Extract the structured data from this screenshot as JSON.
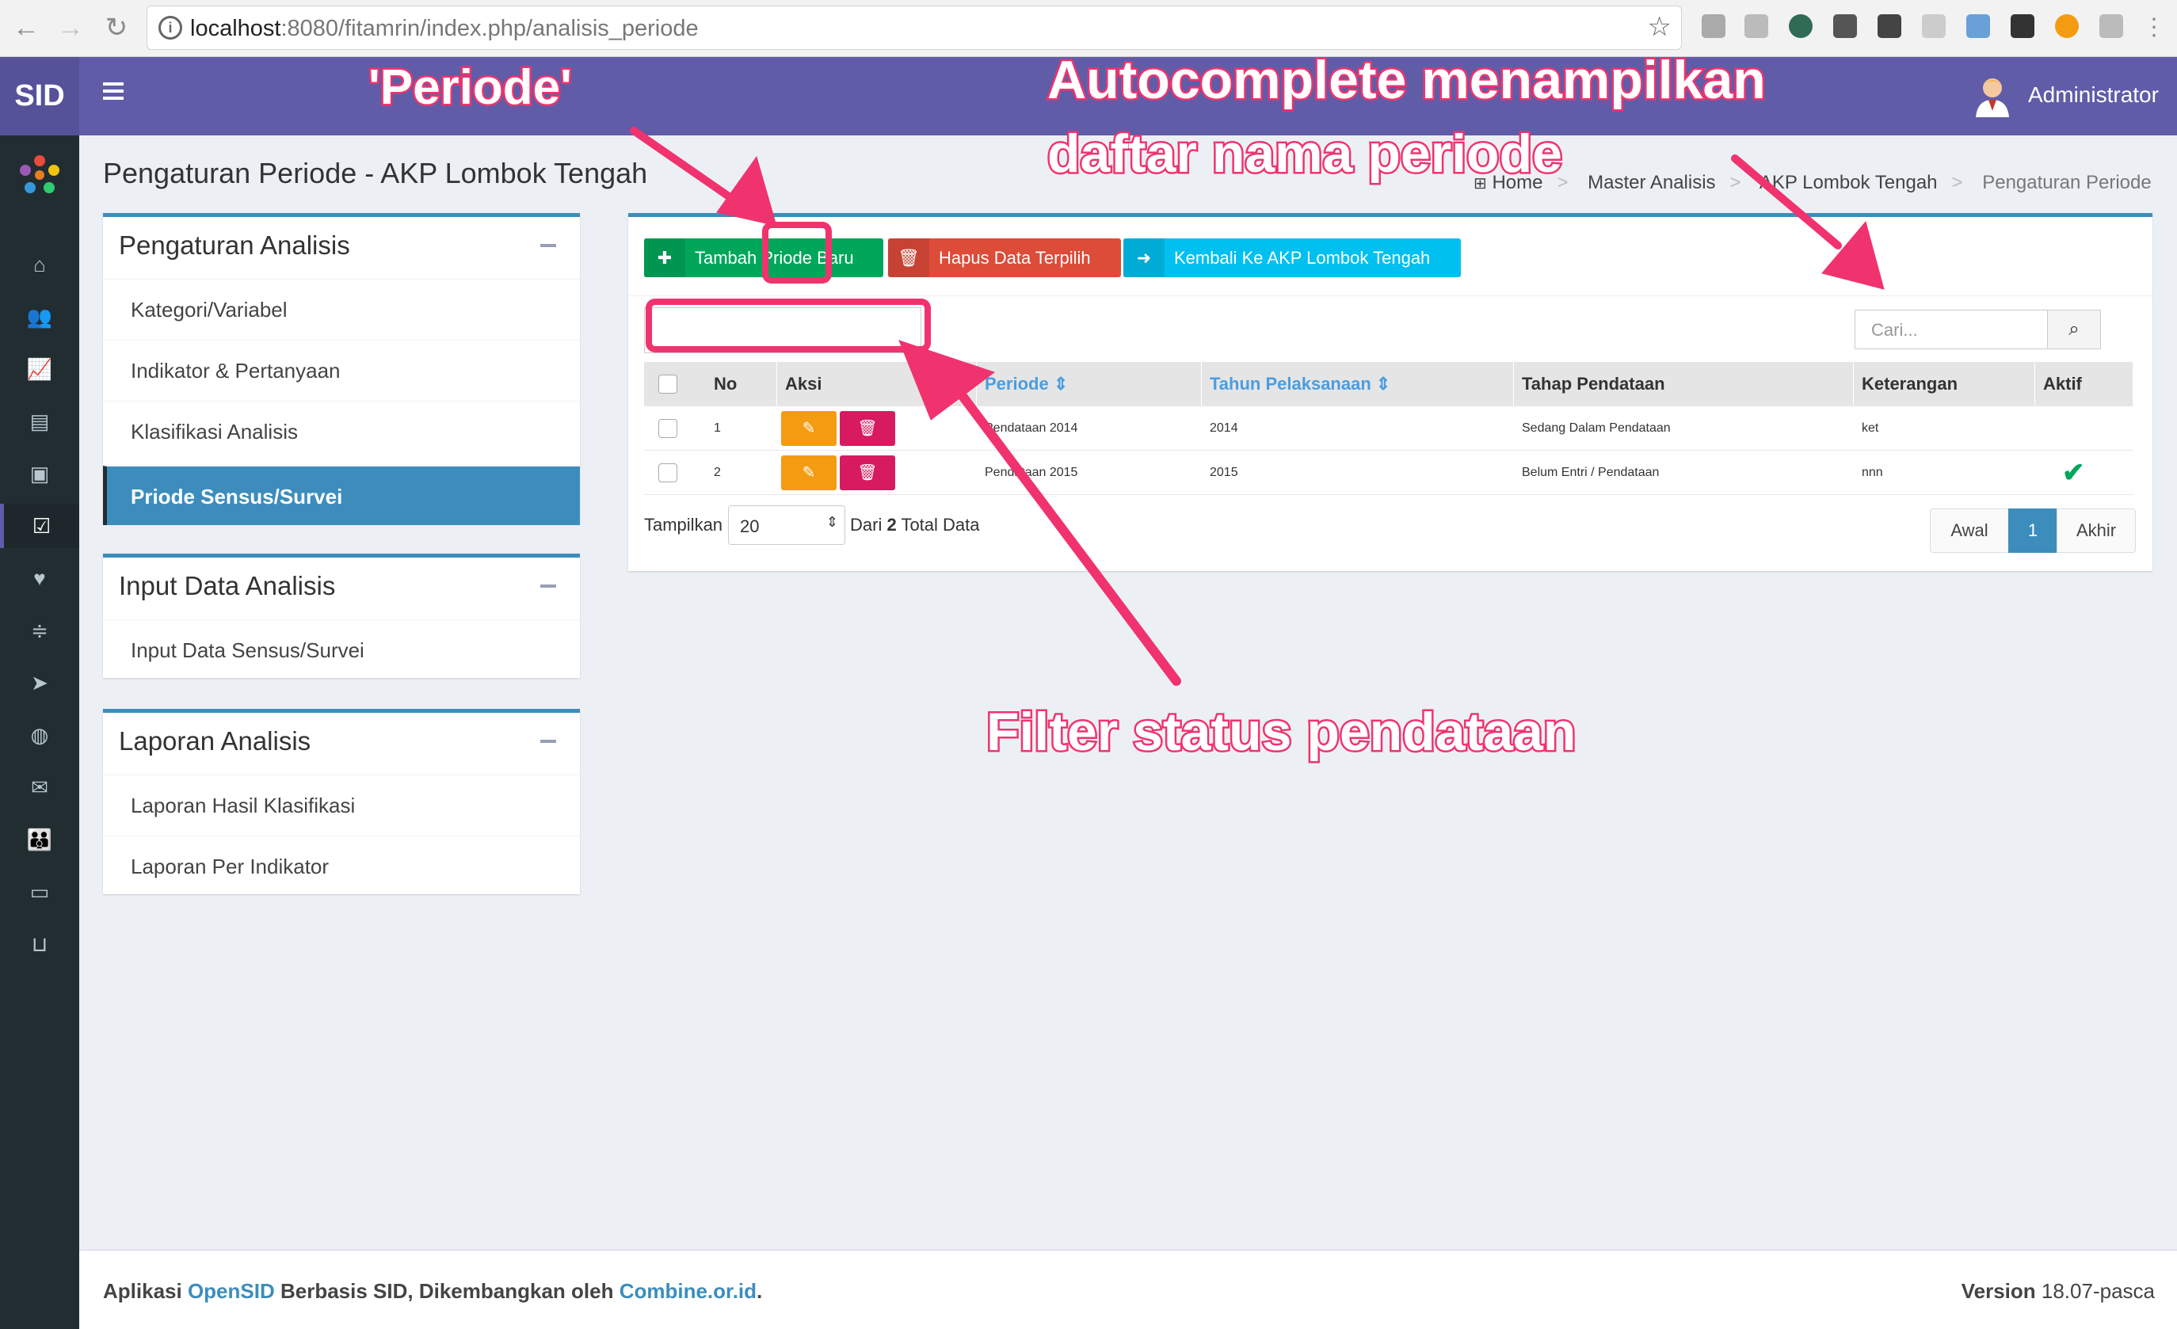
{
  "browser": {
    "url_host": "localhost",
    "url_path": ":8080/fitamrin/index.php/analisis_periode"
  },
  "header": {
    "logo_text": "SID",
    "user_name": "Administrator"
  },
  "page": {
    "title": "Pengaturan Periode - AKP Lombok Tengah",
    "breadcrumb": [
      "Home",
      "Master Analisis",
      "AKP Lombok Tengah",
      "Pengaturan Periode"
    ]
  },
  "sidebar_icons": [
    "home-icon",
    "users-icon",
    "chart-line-icon",
    "book-icon",
    "archive-icon",
    "check-square-icon",
    "heart-icon",
    "sliders-icon",
    "location-arrow-icon",
    "globe-icon",
    "envelope-icon",
    "group-icon",
    "desktop-icon",
    "inbox-icon"
  ],
  "left_menu": {
    "sections": [
      {
        "title": "Pengaturan Analisis",
        "items": [
          "Kategori/Variabel",
          "Indikator & Pertanyaan",
          "Klasifikasi Analisis",
          "Priode Sensus/Survei"
        ],
        "active_index": 3
      },
      {
        "title": "Input Data Analisis",
        "items": [
          "Input Data Sensus/Survei"
        ]
      },
      {
        "title": "Laporan Analisis",
        "items": [
          "Laporan Hasil Klasifikasi",
          "Laporan Per Indikator"
        ]
      }
    ]
  },
  "toolbar": {
    "add_label": "Tambah Priode Baru",
    "delete_label": "Hapus Data Terpilih",
    "back_label": "Kembali Ke AKP Lombok Tengah"
  },
  "search": {
    "placeholder": "Cari..."
  },
  "table": {
    "headers": [
      "No",
      "Aksi",
      "Periode",
      "Tahun Pelaksanaan",
      "Tahap Pendataan",
      "Keterangan",
      "Aktif"
    ],
    "rows": [
      {
        "no": "1",
        "periode": "Pendataan 2014",
        "tahun": "2014",
        "tahap": "Sedang Dalam Pendataan",
        "keterangan": "ket",
        "aktif": false
      },
      {
        "no": "2",
        "periode": "Pendataan 2015",
        "tahun": "2015",
        "tahap": "Belum Entri / Pendataan",
        "keterangan": "nnn",
        "aktif": true
      }
    ]
  },
  "pagination": {
    "show_label": "Tampilkan",
    "per_page": "20",
    "summary_prefix": "Dari",
    "total": "2",
    "summary_suffix": "Total Data",
    "first": "Awal",
    "current": "1",
    "last": "Akhir"
  },
  "footer": {
    "prefix": "Aplikasi",
    "app": "OpenSID",
    "middle": "Berbasis SID, Dikembangkan oleh",
    "org": "Combine.or.id",
    "end": ".",
    "version_label": "Version",
    "version": "18.07-pasca"
  },
  "annotations": {
    "periode": "'Periode'",
    "autocomplete_line1": "Autocomplete menampilkan",
    "autocomplete_line2": "daftar nama periode",
    "filter": "Filter status pendataan",
    "color": "#f0336e"
  },
  "colors": {
    "header": "#605ca8",
    "sidebar": "#222d32",
    "primary": "#3c8dbc",
    "success": "#00a65a",
    "danger": "#dd4b39",
    "info": "#00c0ef"
  }
}
